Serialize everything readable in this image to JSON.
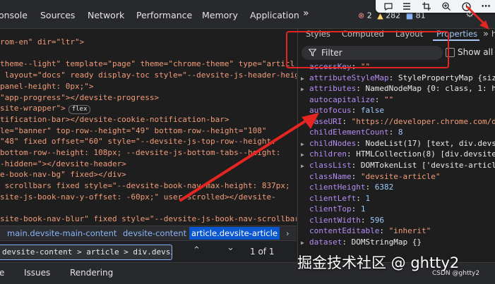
{
  "top_tabs": [
    "onsole",
    "Sources",
    "Network",
    "Performance",
    "Memory",
    "Application"
  ],
  "counters": {
    "errors": "2",
    "warnings": "282",
    "info": "81"
  },
  "elements_lines": [
    {
      "indent": 0,
      "parts": [
        {
          "t": "rom-en\" dir=\"ltr\">",
          "c": "c-val"
        }
      ]
    },
    {
      "indent": 0,
      "parts": []
    },
    {
      "indent": 0,
      "parts": [
        {
          "t": "theme--light\" template=\"page\" theme=\"chrome-theme\" type=\"articl",
          "c": "c-val"
        }
      ]
    },
    {
      "indent": 0,
      "parts": [
        {
          "t": " layout=\"docs\" ready display-toc style=\"--devsite-js-header-heig",
          "c": "c-val"
        }
      ]
    },
    {
      "indent": 0,
      "parts": [
        {
          "t": "panel-height: 0px;\">",
          "c": "c-val"
        }
      ]
    },
    {
      "indent": 0,
      "parts": [
        {
          "t": "\"app-progress\"></devsite-progress>",
          "c": "c-val"
        }
      ]
    },
    {
      "indent": 0,
      "parts": [
        {
          "t": "site-wrapper\">",
          "c": "c-val"
        }
      ]
    },
    {
      "indent": 0,
      "parts": [
        {
          "t": "tification-bar></devsite-cookie-notification-bar>",
          "c": "c-val"
        }
      ]
    },
    {
      "indent": 0,
      "parts": [
        {
          "t": "le=\"banner\" top-row--height=\"49\" bottom-row--height=\"108\"",
          "c": "c-val"
        }
      ]
    },
    {
      "indent": 0,
      "parts": [
        {
          "t": "\"48\" fixed offset=\"60\" style=\"--devsite-js-top-row--height:",
          "c": "c-val"
        }
      ]
    },
    {
      "indent": 0,
      "parts": [
        {
          "t": "bottom-row--height: 108px; --devsite-js-bottom-tabs--height:",
          "c": "c-val"
        }
      ]
    },
    {
      "indent": 0,
      "parts": [
        {
          "t": "-hidden=\"></devsite-header>",
          "c": "c-val"
        }
      ]
    },
    {
      "indent": 0,
      "parts": [
        {
          "t": "e-book-nav-bg\" fixed></div>",
          "c": "c-val"
        }
      ]
    },
    {
      "indent": 0,
      "parts": [
        {
          "t": " scrollbars fixed style=\"--devsite-book-nav-max-height: 837px;",
          "c": "c-val"
        }
      ]
    },
    {
      "indent": 0,
      "parts": [
        {
          "t": "site-js-book-nav-y-offset: -60px;\" user-scrolled></devsite-",
          "c": "c-val"
        }
      ]
    },
    {
      "indent": 0,
      "parts": []
    },
    {
      "indent": 0,
      "parts": [
        {
          "t": "site-book-nav-blur\" fixed style=\"--devsite-js-book-nav-scrollbar-",
          "c": "c-val"
        }
      ]
    }
  ],
  "flex_badge": "flex",
  "breadcrumb": [
    "main.devsite-main-content",
    "devsite-content",
    "article.devsite-article"
  ],
  "search": {
    "value": "devsite-content > article > div.devsite-article-bo",
    "match": "1 of 1"
  },
  "drawer_tabs": [
    "e",
    "Issues",
    "Rendering"
  ],
  "right_tabs": [
    "Styles",
    "Computed",
    "Layout",
    "Properties"
  ],
  "filter": {
    "placeholder": "Filter",
    "show_all": "Show all"
  },
  "properties": [
    {
      "arrow": false,
      "key": "accessKey",
      "sep": ": ",
      "val": "\"\"",
      "vc": "p-str"
    },
    {
      "arrow": true,
      "key": "attributeStyleMap",
      "sep": ": ",
      "val": "StylePropertyMap {size",
      "vc": "p-val"
    },
    {
      "arrow": true,
      "key": "attributes",
      "sep": ": ",
      "val": "NamedNodeMap {0: class, 1: ha",
      "vc": "p-val"
    },
    {
      "arrow": false,
      "key": "autocapitalize",
      "sep": ": ",
      "val": "\"\"",
      "vc": "p-str"
    },
    {
      "arrow": false,
      "key": "autofocus",
      "sep": ": ",
      "val": "false",
      "vc": "p-num"
    },
    {
      "arrow": false,
      "key": "baseURI",
      "sep": ": ",
      "val": "\"https://developer.chrome.com/d",
      "vc": "p-str"
    },
    {
      "arrow": false,
      "key": "childElementCount",
      "sep": ": ",
      "val": "8",
      "vc": "p-num"
    },
    {
      "arrow": true,
      "key": "childNodes",
      "sep": ": ",
      "val": "NodeList(17) [text, div.devsi",
      "vc": "p-val"
    },
    {
      "arrow": true,
      "key": "children",
      "sep": ": ",
      "val": "HTMLCollection(8) [div.devsite-",
      "vc": "p-val"
    },
    {
      "arrow": true,
      "key": "classList",
      "sep": ": ",
      "val": "DOMTokenList ['devsite-article",
      "vc": "p-val"
    },
    {
      "arrow": false,
      "key": "className",
      "sep": ": ",
      "val": "\"devsite-article\"",
      "vc": "p-str"
    },
    {
      "arrow": false,
      "key": "clientHeight",
      "sep": ": ",
      "val": "6382",
      "vc": "p-num"
    },
    {
      "arrow": false,
      "key": "clientLeft",
      "sep": ": ",
      "val": "1",
      "vc": "p-num"
    },
    {
      "arrow": false,
      "key": "clientTop",
      "sep": ": ",
      "val": "1",
      "vc": "p-num"
    },
    {
      "arrow": false,
      "key": "clientWidth",
      "sep": ": ",
      "val": "596",
      "vc": "p-num"
    },
    {
      "arrow": false,
      "key": "contentEditable",
      "sep": ": ",
      "val": "\"inherit\"",
      "vc": "p-str"
    },
    {
      "arrow": true,
      "key": "dataset",
      "sep": ": ",
      "val": "DOMStringMap {}",
      "vc": "p-val"
    }
  ],
  "watermark": {
    "main": "掘金技术社区 @ ghtty2",
    "small": "CSDN @ghtty2"
  },
  "colors": {
    "accent": "#a8c7fa",
    "annotation_red": "#e52521",
    "error": "#f28b82",
    "warning": "#fdd663",
    "info": "#8ab4f8"
  },
  "icons": [
    "comment-icon",
    "list-icon",
    "crop-icon",
    "zoom-in-icon",
    "timer-icon",
    "more-icon",
    "settings-icon",
    "more-tabs-icon"
  ]
}
